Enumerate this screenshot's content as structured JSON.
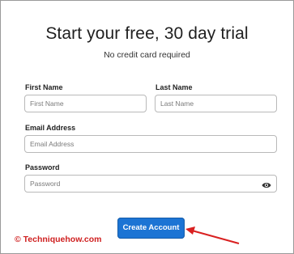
{
  "header": {
    "title": "Start your free, 30 day trial",
    "subtitle": "No credit card required"
  },
  "form": {
    "first_name": {
      "label": "First Name",
      "placeholder": "First Name"
    },
    "last_name": {
      "label": "Last Name",
      "placeholder": "Last Name"
    },
    "email": {
      "label": "Email Address",
      "placeholder": "Email Address"
    },
    "password": {
      "label": "Password",
      "placeholder": "Password"
    },
    "submit_label": "Create Account"
  },
  "watermark": "© Techniquehow.com",
  "colors": {
    "button_bg": "#1c74d4",
    "watermark": "#cf1f1f",
    "arrow": "#d92020"
  },
  "icons": [
    "eye-icon",
    "arrow-annotation-icon"
  ]
}
